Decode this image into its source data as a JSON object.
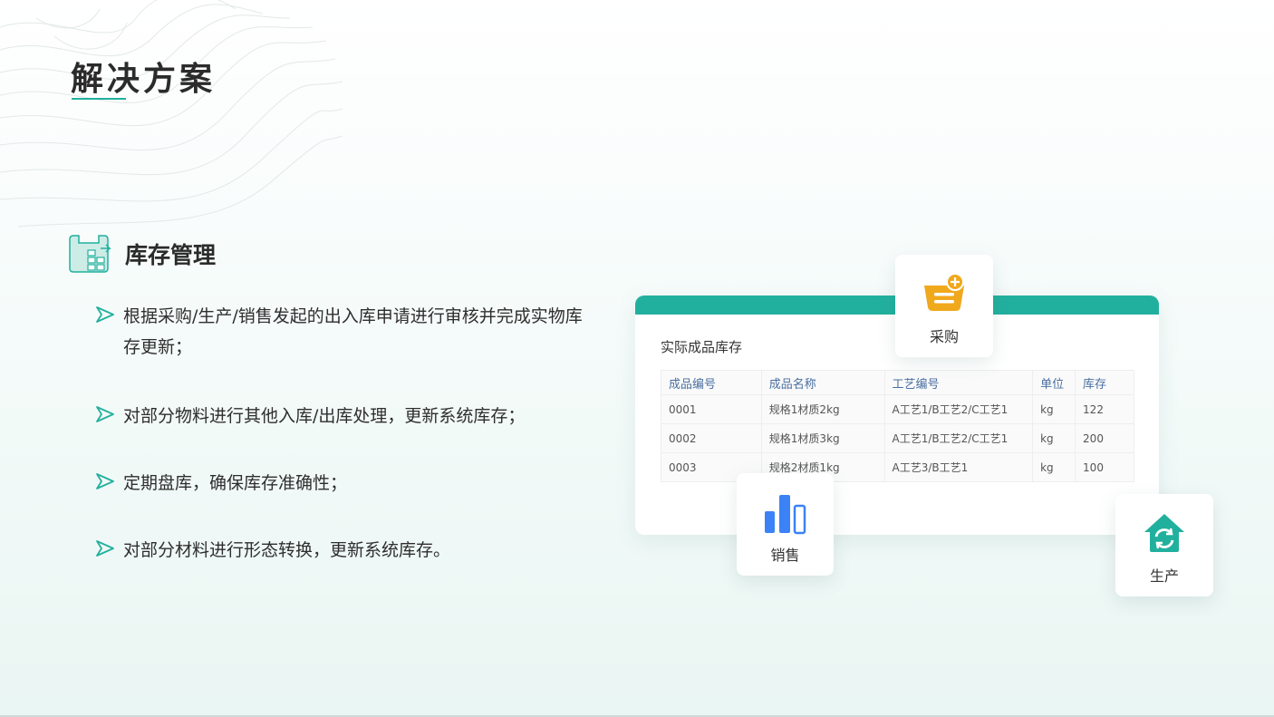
{
  "page": {
    "title": "解决方案",
    "accent": "#22b09e"
  },
  "section": {
    "title": "库存管理",
    "icon": "warehouse-box-icon"
  },
  "bullets": [
    "根据采购/生产/销售发起的出入库申请进行审核并完成实物库存更新；",
    "对部分物料进行其他入库/出库处理，更新系统库存；",
    "定期盘库，确保库存准确性；",
    "对部分材料进行形态转换，更新系统库存。"
  ],
  "inventory": {
    "title": "实际成品库存",
    "columns": [
      "成品编号",
      "成品名称",
      "工艺编号",
      "单位",
      "库存"
    ],
    "rows": [
      [
        "0001",
        "规格1材质2kg",
        "A工艺1/B工艺2/C工艺1",
        "kg",
        "122"
      ],
      [
        "0002",
        "规格1材质3kg",
        "A工艺1/B工艺2/C工艺1",
        "kg",
        "200"
      ],
      [
        "0003",
        "规格2材质1kg",
        "A工艺3/B工艺1",
        "kg",
        "100"
      ]
    ]
  },
  "modules": {
    "purchase": {
      "label": "采购",
      "icon": "basket-plus-icon",
      "color": "#f0a81c"
    },
    "sales": {
      "label": "销售",
      "icon": "bar-chart-icon",
      "color": "#3b82f6"
    },
    "production": {
      "label": "生产",
      "icon": "house-refresh-icon",
      "color": "#22b09e"
    }
  }
}
